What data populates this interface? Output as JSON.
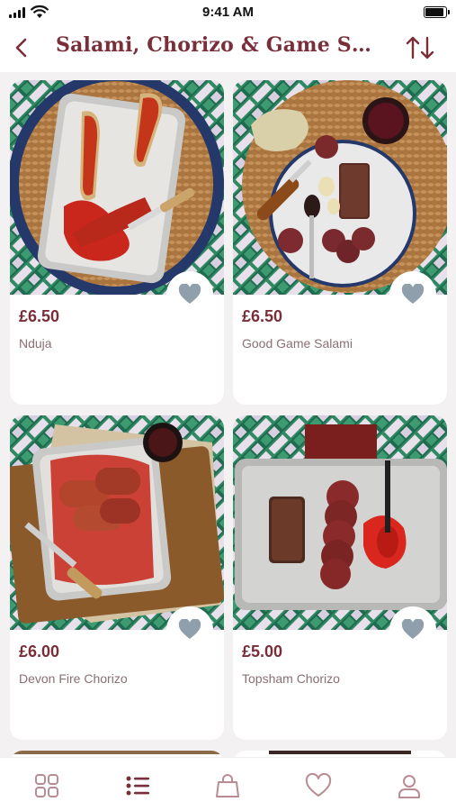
{
  "status_bar": {
    "time": "9:41 AM"
  },
  "header": {
    "title": "Salami, Chorizo & Game Salami"
  },
  "products": [
    {
      "price": "£6.50",
      "name": "Nduja"
    },
    {
      "price": "£6.50",
      "name": "Good Game Salami"
    },
    {
      "price": "£6.00",
      "name": "Devon Fire Chorizo"
    },
    {
      "price": "£5.00",
      "name": "Topsham Chorizo"
    }
  ],
  "tabs": [
    "grid-icon",
    "list-icon",
    "bag-icon",
    "heart-icon",
    "user-icon"
  ],
  "colors": {
    "accent": "#7a2e3a",
    "icon_muted": "#b98b92",
    "heart": "#8fa0ac",
    "background": "#f3f1f1"
  }
}
